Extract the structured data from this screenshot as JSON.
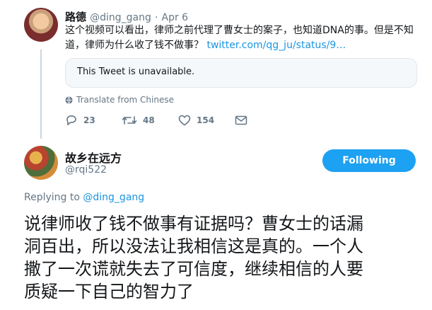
{
  "tweet1": {
    "display_name": "路德",
    "handle": "@ding_gang",
    "separator": "·",
    "date": "Apr 6",
    "text_line1": "这个视频可以看出，律师之前代理了曹女士的案子，也知道DNA的事。但是不知",
    "text_line2": "道，律师为什么收了钱不做事？",
    "link_text": "twitter.com/qg_ju/status/9…",
    "quote_text": "This Tweet is unavailable.",
    "translate_label": "Translate from Chinese",
    "reply_count": "23",
    "retweet_count": "48",
    "like_count": "154"
  },
  "tweet2": {
    "display_name": "故乡在远方",
    "handle": "@rqi522",
    "follow_label": "Following",
    "replying_prefix": "Replying to",
    "replying_handle": "@ding_gang",
    "body_line1": "说律师收了钱不做事有证据吗？曹女士的话漏",
    "body_line2": "洞百出，所以没法让我相信这是真的。一个人",
    "body_line3": "撒了一次谎就失去了可信度，继续相信的人要",
    "body_line4": "质疑一下自己的智力了"
  },
  "colors": {
    "accent": "#1da1f2",
    "link": "#1b95e0",
    "muted": "#657786",
    "border": "#e1e8ed"
  }
}
